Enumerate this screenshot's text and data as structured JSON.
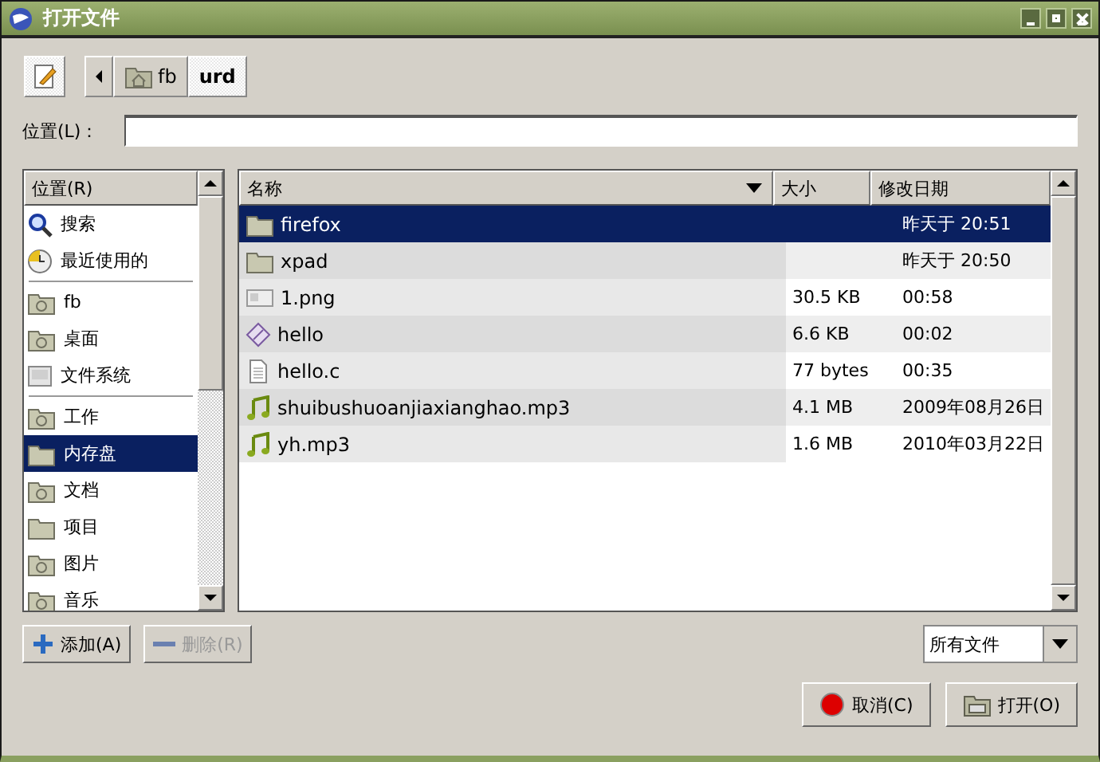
{
  "window": {
    "title": "打开文件"
  },
  "path_bar": {
    "buttons": [
      {
        "label": "fb",
        "kind": "home",
        "selected": false
      },
      {
        "label": "urd",
        "kind": "plain",
        "selected": true
      }
    ]
  },
  "location": {
    "label": "位置(L)："
  },
  "sidebar": {
    "header": "位置(R)",
    "sections": [
      [
        {
          "label": "搜索",
          "kind": "search",
          "selected": false
        },
        {
          "label": "最近使用的",
          "kind": "recent",
          "selected": false
        }
      ],
      [
        {
          "label": "fb",
          "kind": "home",
          "selected": false
        },
        {
          "label": "桌面",
          "kind": "desktop",
          "selected": false
        },
        {
          "label": "文件系统",
          "kind": "drive",
          "selected": false
        }
      ],
      [
        {
          "label": "工作",
          "kind": "download",
          "selected": false
        },
        {
          "label": "内存盘",
          "kind": "folder",
          "selected": true
        },
        {
          "label": "文档",
          "kind": "documents",
          "selected": false
        },
        {
          "label": "项目",
          "kind": "folder",
          "selected": false
        },
        {
          "label": "图片",
          "kind": "pictures",
          "selected": false
        },
        {
          "label": "音乐",
          "kind": "music",
          "selected": false
        }
      ]
    ]
  },
  "files": {
    "columns": [
      "名称",
      "大小",
      "修改日期"
    ],
    "rows": [
      {
        "name": "firefox",
        "size": "",
        "modified": "昨天于 20:51",
        "kind": "folder",
        "selected": true
      },
      {
        "name": "xpad",
        "size": "",
        "modified": "昨天于 20:50",
        "kind": "folder",
        "selected": false
      },
      {
        "name": "1.png",
        "size": "30.5 KB",
        "modified": "00:58",
        "kind": "image",
        "selected": false
      },
      {
        "name": "hello",
        "size": "6.6 KB",
        "modified": "00:02",
        "kind": "binary",
        "selected": false
      },
      {
        "name": "hello.c",
        "size": "77 bytes",
        "modified": "00:35",
        "kind": "text",
        "selected": false
      },
      {
        "name": "shuibushuoanjiaxianghao.mp3",
        "size": "4.1 MB",
        "modified": "2009年08月26日",
        "kind": "audio",
        "selected": false
      },
      {
        "name": "yh.mp3",
        "size": "1.6 MB",
        "modified": "2010年03月22日",
        "kind": "audio",
        "selected": false
      }
    ]
  },
  "add_button": {
    "label": "添加(A)",
    "disabled": false
  },
  "remove_button": {
    "label": "删除(R)",
    "disabled": true
  },
  "filter": {
    "value": "所有文件"
  },
  "buttons": [
    {
      "label": "取消(C)",
      "kind": "cancel"
    },
    {
      "label": "打开(O)",
      "kind": "open"
    }
  ]
}
